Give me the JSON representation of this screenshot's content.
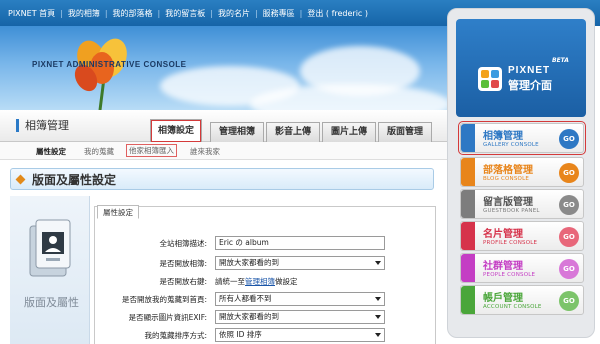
{
  "topnav": {
    "links": [
      "PIXNET 首頁",
      "我的相簿",
      "我的部落格",
      "我的留言板",
      "我的名片",
      "服務專區",
      "登出 ( frederic )"
    ]
  },
  "banner": {
    "title": "PIXNET ADMINISTRATIVE CONSOLE"
  },
  "section": {
    "title": "相簿管理"
  },
  "tabs": [
    {
      "label": "相簿設定",
      "active": true
    },
    {
      "label": "管理相簿",
      "active": false
    },
    {
      "label": "影音上傳",
      "active": false
    },
    {
      "label": "圖片上傳",
      "active": false
    },
    {
      "label": "版面管理",
      "active": false
    }
  ],
  "subtabs": [
    "屬性設定",
    "我的蒐藏",
    "他家相簿匯入",
    "誰來我家"
  ],
  "page": {
    "heading": "版面及屬性設定",
    "icon_label": "版面及屬性"
  },
  "form": {
    "tab_label": "屬性設定",
    "rows": [
      {
        "label": "全站相簿描述:",
        "value": "Eric の album",
        "kind": "text"
      },
      {
        "label": "是否開放相簿:",
        "value": "開放大家都看的到",
        "kind": "select"
      },
      {
        "label": "是否開放右鍵:",
        "text_before": "請統一至",
        "link": "管理相簿",
        "text_after": "做設定",
        "kind": "plain"
      },
      {
        "label": "是否開放我的蒐藏到首頁:",
        "value": "所有人都看不到",
        "kind": "select"
      },
      {
        "label": "是否顯示圖片資訊EXIF:",
        "value": "開放大家都看的到",
        "kind": "select"
      },
      {
        "label": "我的蒐藏排序方式:",
        "value": "依照 ID 排序",
        "kind": "select"
      }
    ]
  },
  "sidebar": {
    "logo": {
      "brand": "PIXNET",
      "subtitle": "管理介面",
      "beta": "BETA"
    },
    "consoles": [
      {
        "title": "相簿管理",
        "subtitle": "GALLERY CONSOLE",
        "color": "#2e78c4",
        "selected": true
      },
      {
        "title": "部落格管理",
        "subtitle": "BLOG CONSOLE",
        "color": "#e8851b",
        "selected": false
      },
      {
        "title": "留言版管理",
        "subtitle": "GUESTBOOK PANEL",
        "color": "#7d7d7d",
        "selected": false
      },
      {
        "title": "名片管理",
        "subtitle": "PROFILE CONSOLE",
        "color": "#d6334b",
        "selected": false
      },
      {
        "title": "社群管理",
        "subtitle": "PEOPLE CONSOLE",
        "color": "#c43ec4",
        "selected": false
      },
      {
        "title": "帳戶管理",
        "subtitle": "ACCOUNT CONSOLE",
        "color": "#4aa63a",
        "selected": false
      }
    ],
    "go_label": "GO"
  }
}
